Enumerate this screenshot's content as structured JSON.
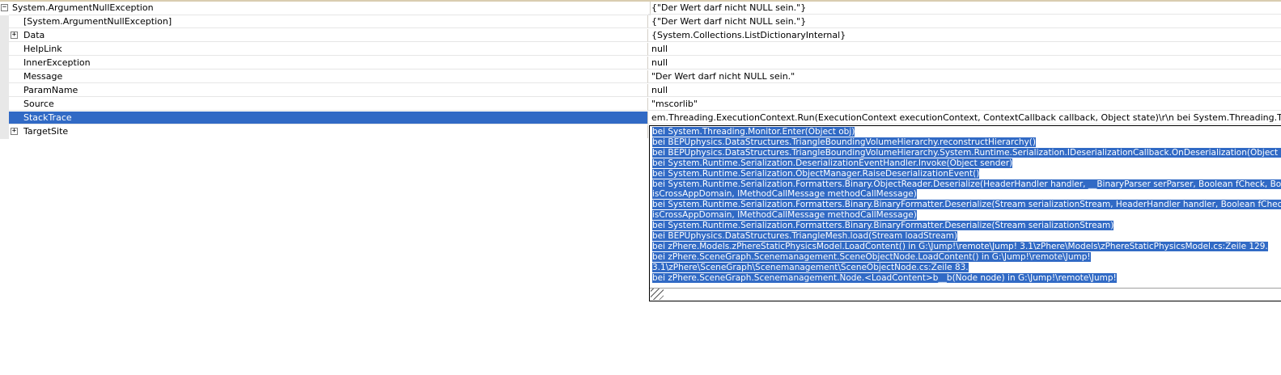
{
  "colors": {
    "selection": "#316ac5",
    "gutter": "#e8e8e8"
  },
  "icons": {
    "collapse": "minus-box-icon",
    "expand": "plus-box-icon"
  },
  "rows": [
    {
      "name": "System.ArgumentNullException",
      "value": "{\"Der Wert darf nicht NULL sein.\"}",
      "expander": "⊟"
    },
    {
      "name": "[System.ArgumentNullException]",
      "value": "{\"Der Wert darf nicht NULL sein.\"}",
      "expander": ""
    },
    {
      "name": "Data",
      "value": "{System.Collections.ListDictionaryInternal}",
      "expander": "+"
    },
    {
      "name": "HelpLink",
      "value": "null",
      "expander": ""
    },
    {
      "name": "InnerException",
      "value": "null",
      "expander": ""
    },
    {
      "name": "Message",
      "value": "\"Der Wert darf nicht NULL sein.\"",
      "expander": ""
    },
    {
      "name": "ParamName",
      "value": "null",
      "expander": ""
    },
    {
      "name": "Source",
      "value": "\"mscorlib\"",
      "expander": ""
    },
    {
      "name": "StackTrace",
      "value": "em.Threading.ExecutionContext.Run(ExecutionContext executionContext, ContextCallback callback, Object state)\\r\\n   bei System.Threading.ThreadHelper.Th",
      "expander": ""
    },
    {
      "name": "TargetSite",
      "value": "",
      "expander": "+"
    }
  ],
  "stack_trace_lines": [
    "   bei System.Threading.Monitor.Enter(Object obj)",
    "   bei BEPUphysics.DataStructures.TriangleBoundingVolumeHierarchy.reconstructHierarchy()",
    "   bei BEPUphysics.DataStructures.TriangleBoundingVolumeHierarchy.System.Runtime.Serialization.IDeserializationCallback.OnDeserialization(Object sender)",
    "   bei System.Runtime.Serialization.DeserializationEventHandler.Invoke(Object sender)",
    "   bei System.Runtime.Serialization.ObjectManager.RaiseDeserializationEvent()",
    "   bei System.Runtime.Serialization.Formatters.Binary.ObjectReader.Deserialize(HeaderHandler handler, __BinaryParser serParser, Boolean fCheck, Boolean",
    "isCrossAppDomain, IMethodCallMessage methodCallMessage)",
    "   bei System.Runtime.Serialization.Formatters.Binary.BinaryFormatter.Deserialize(Stream serializationStream, HeaderHandler handler, Boolean fCheck, Boolean",
    "isCrossAppDomain, IMethodCallMessage methodCallMessage)",
    "   bei System.Runtime.Serialization.Formatters.Binary.BinaryFormatter.Deserialize(Stream serializationStream)",
    "   bei BEPUphysics.DataStructures.TriangleMesh.load(Stream loadStream)",
    "   bei zPhere.Models.zPhereStaticPhysicsModel.LoadContent() in G:\\Jump!\\remote\\Jump! 3.1\\zPhere\\Models\\zPhereStaticPhysicsModel.cs:Zeile 129.",
    "   bei zPhere.SceneGraph.Scenemanagement.SceneObjectNode.LoadContent() in G:\\Jump!\\remote\\Jump!",
    "3.1\\zPhere\\SceneGraph\\Scenemanagement\\SceneObjectNode.cs:Zeile 83.",
    "   bei zPhere.SceneGraph.Scenemanagement.Node.<LoadContent>b__b(Node node) in G:\\Jump!\\remote\\Jump!"
  ]
}
